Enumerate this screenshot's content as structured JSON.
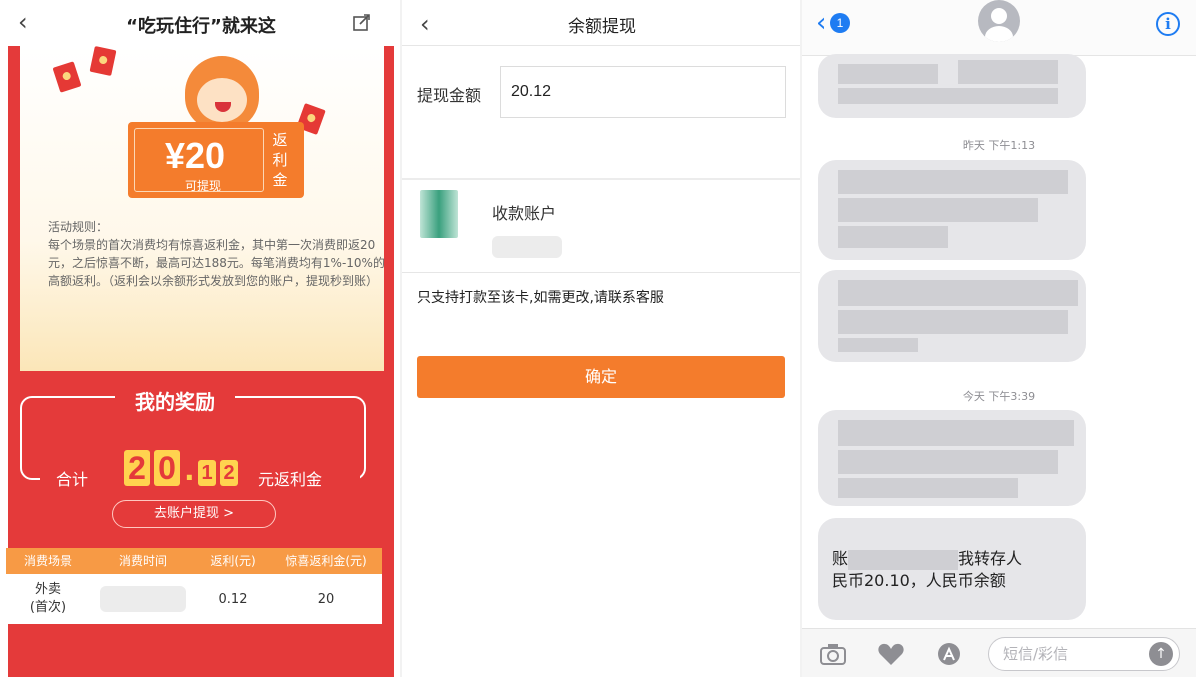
{
  "panel1": {
    "title": "“吃玩住行”就来这",
    "back_icon": "chevron-left-icon",
    "share_icon": "share-icon",
    "ticket": {
      "amount": "¥20",
      "sub": "可提现",
      "side": "返利金"
    },
    "rules": {
      "heading": "活动规则：",
      "body": "每个场景的首次消费均有惊喜返利金，其中第一次消费即返20元，之后惊喜不断，最高可达188元。每笔消费均有1%-10%的高额返利。（返利会以余额形式发放到您的账户，提现秒到账）"
    },
    "reward": {
      "title": "我的奖励",
      "total_label": "合计",
      "digits": [
        "2",
        "0",
        "1",
        "2"
      ],
      "dot": ".",
      "unit": "元返利金",
      "goto_button": "去账户提现 >"
    },
    "table": {
      "headers": [
        "消费场景",
        "消费时间",
        "返利(元)",
        "惊喜返利金(元)"
      ],
      "rows": [
        {
          "scene_line1": "外卖",
          "scene_line2": "(首次)",
          "time": "",
          "rebate": "0.12",
          "bonus": "20"
        }
      ]
    },
    "colors": {
      "primary_red": "#e43a3a",
      "orange": "#f47c2c",
      "gold": "#ffd34f"
    }
  },
  "panel2": {
    "title": "余额提现",
    "back_icon": "chevron-left-icon",
    "amount_label": "提现金额",
    "amount_value": "20.12",
    "account_label": "收款账户",
    "bank_icon": "bank-card-icon",
    "note": "只支持打款至该卡,如需更改,请联系客服",
    "confirm_button": "确定"
  },
  "panel3": {
    "back_badge": "1",
    "info_icon": "info-icon",
    "info_glyph": "i",
    "timestamps": [
      "昨天 下午1:13",
      "今天 下午3:39"
    ],
    "last_message_line1_start": "账",
    "last_message_line1_end": "我转存人",
    "last_message_line2": "民币20.10，人民币余额",
    "input_placeholder": "短信/彩信",
    "toolbar_icons": [
      "camera-icon",
      "digital-touch-icon",
      "app-store-icon"
    ],
    "colors": {
      "ios_blue": "#1e7cf2",
      "bubble_gray": "#e6e6e9"
    }
  }
}
